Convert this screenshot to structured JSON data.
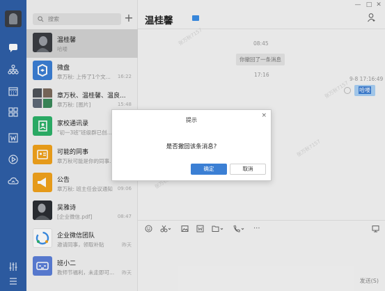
{
  "rail": {
    "items": [
      "chat-bubble-icon",
      "org-chart-icon",
      "calendar-icon",
      "apps-grid-icon",
      "doc-w-icon",
      "play-icon",
      "cloud-icon"
    ],
    "bottom": [
      "sliders-icon",
      "menu-icon"
    ]
  },
  "list": {
    "search_placeholder": "搜索",
    "add_label": "+",
    "conversations": [
      {
        "name": "温桂馨",
        "preview": "哈喽",
        "time": "",
        "avatar": "photo-avatar"
      },
      {
        "name": "微盘",
        "preview": "章万秋: 上传了1个文...",
        "time": "16:22",
        "avatar": "cloud-drive-avatar"
      },
      {
        "name": "章万秋、温桂馨、温良...",
        "preview": "章万秋: [图片]",
        "time": "15:48",
        "avatar": "group-avatar"
      },
      {
        "name": "家校通讯录",
        "preview": "\"初一3班\"班级群已创...",
        "time": "",
        "avatar": "contacts-avatar"
      },
      {
        "name": "可能的同事",
        "preview": "章万秋可能是你的同事...",
        "time": "",
        "avatar": "colleague-avatar"
      },
      {
        "name": "公告",
        "preview": "章万秋: 班主任会议通知",
        "time": "09:06",
        "avatar": "announcement-avatar"
      },
      {
        "name": "吴雅诗",
        "preview": "[企业微信.pdf]",
        "time": "08:47",
        "avatar": "photo-avatar"
      },
      {
        "name": "企业微信团队",
        "preview": "邀请同事，领取补贴",
        "time": "昨天",
        "avatar": "wecom-team-avatar"
      },
      {
        "name": "班小二",
        "preview": "教师节福利，未走即可...",
        "time": "昨天",
        "avatar": "banxiaoer-avatar"
      }
    ]
  },
  "chat": {
    "title": "温桂馨",
    "timestamps": [
      "08:45",
      "17:16"
    ],
    "system_msg": "你撤回了一条消息",
    "msg_time": "9-8 17:16:49",
    "msg_text": "哈喽",
    "send_label": "发送(S)",
    "watermark": "张万秋7157"
  },
  "dialog": {
    "title": "提示",
    "message": "是否撤回该条消息?",
    "ok_label": "确定",
    "cancel_label": "取消",
    "close_label": "×"
  },
  "colors": {
    "rail_bg": "#2f5fa8",
    "primary_button": "#3b7fd4",
    "selected_bubble": "#a9d0f5"
  }
}
